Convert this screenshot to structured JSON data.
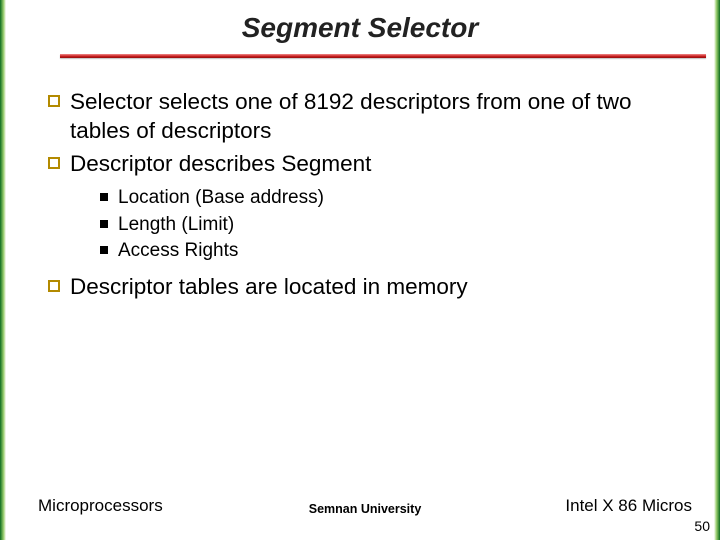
{
  "title": "Segment Selector",
  "bullets": [
    {
      "text": "Selector selects one of 8192 descriptors from one of two tables of descriptors"
    },
    {
      "text": "Descriptor describes Segment",
      "sub": [
        "Location (Base address)",
        "Length (Limit)",
        "Access Rights"
      ]
    },
    {
      "text": "Descriptor tables are located in memory"
    }
  ],
  "footer": {
    "left": "Microprocessors",
    "center": "Semnan University",
    "right": "Intel X 86 Micros"
  },
  "page_number": "50"
}
